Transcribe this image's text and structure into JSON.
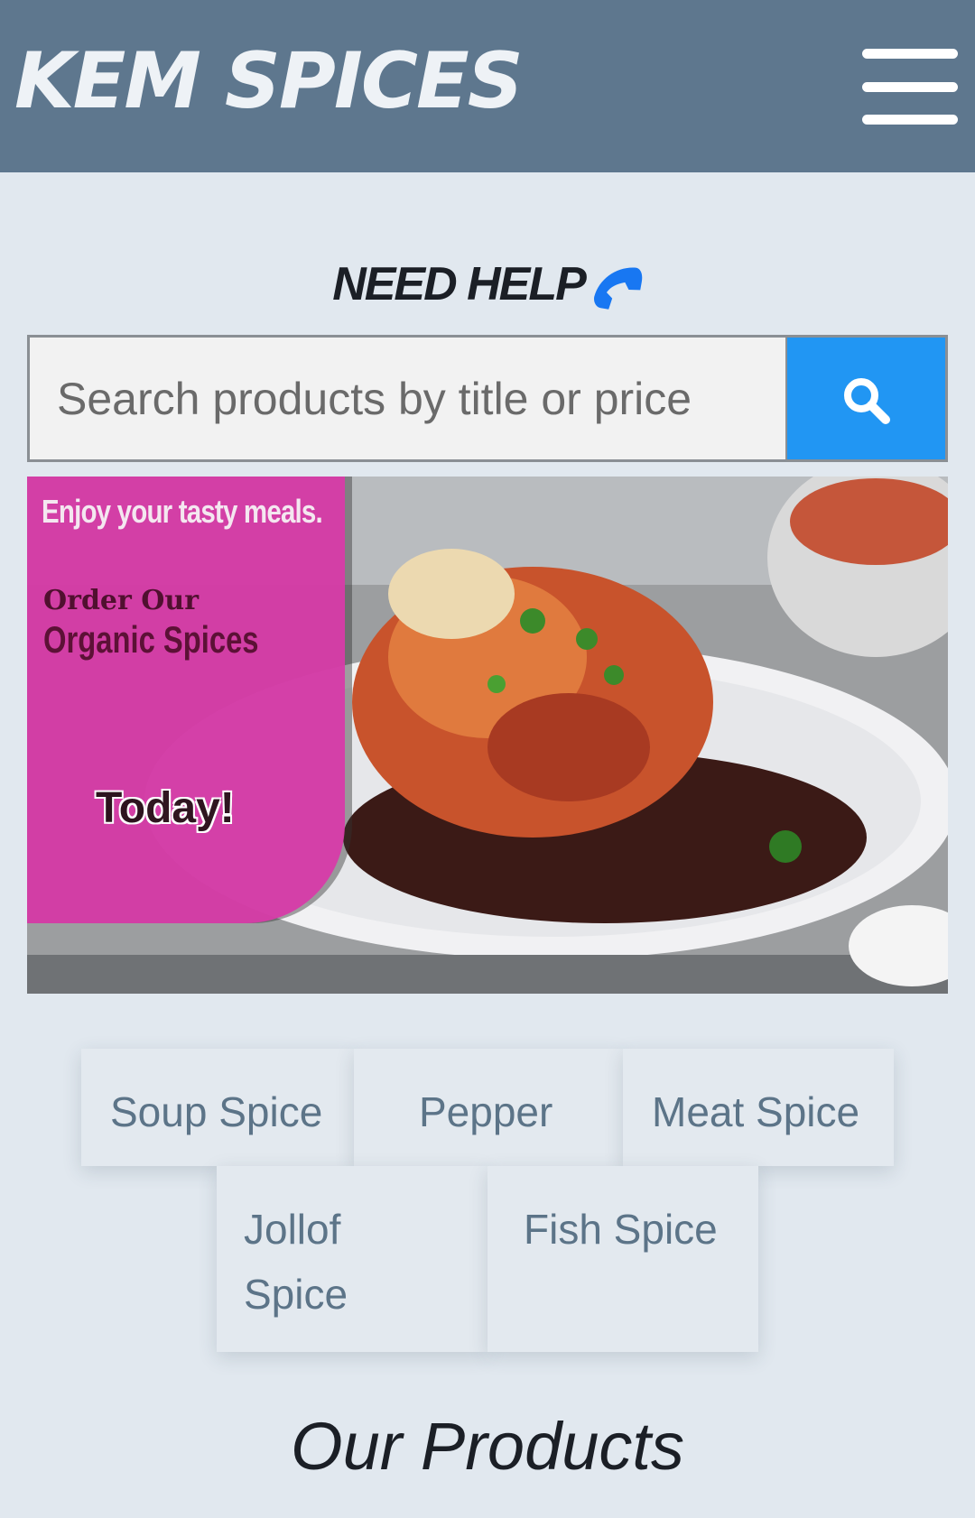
{
  "header": {
    "brand": "KEM SPICES",
    "menu_icon": "hamburger-menu-icon"
  },
  "help": {
    "label": "NEED HELP",
    "icon": "phone-icon",
    "icon_color": "#1877f2"
  },
  "search": {
    "placeholder": "Search products by title or price",
    "value": "",
    "button_icon": "search-icon",
    "button_color": "#2196f3"
  },
  "banner": {
    "line1": "Enjoy your tasty meals.",
    "line2": "Order Our",
    "line3": "Organic Spices",
    "line4": "Today!",
    "panel_color": "#d43ba6"
  },
  "categories": [
    {
      "label": "Soup Spice"
    },
    {
      "label": "Pepper"
    },
    {
      "label": "Meat Spice"
    },
    {
      "label": "Jollof Spice"
    },
    {
      "label": "Fish Spice"
    }
  ],
  "products": {
    "title": "Our Products"
  },
  "colors": {
    "header_bg": "#5e778e",
    "page_bg": "#e1e8ef",
    "category_text": "#5c7488"
  }
}
